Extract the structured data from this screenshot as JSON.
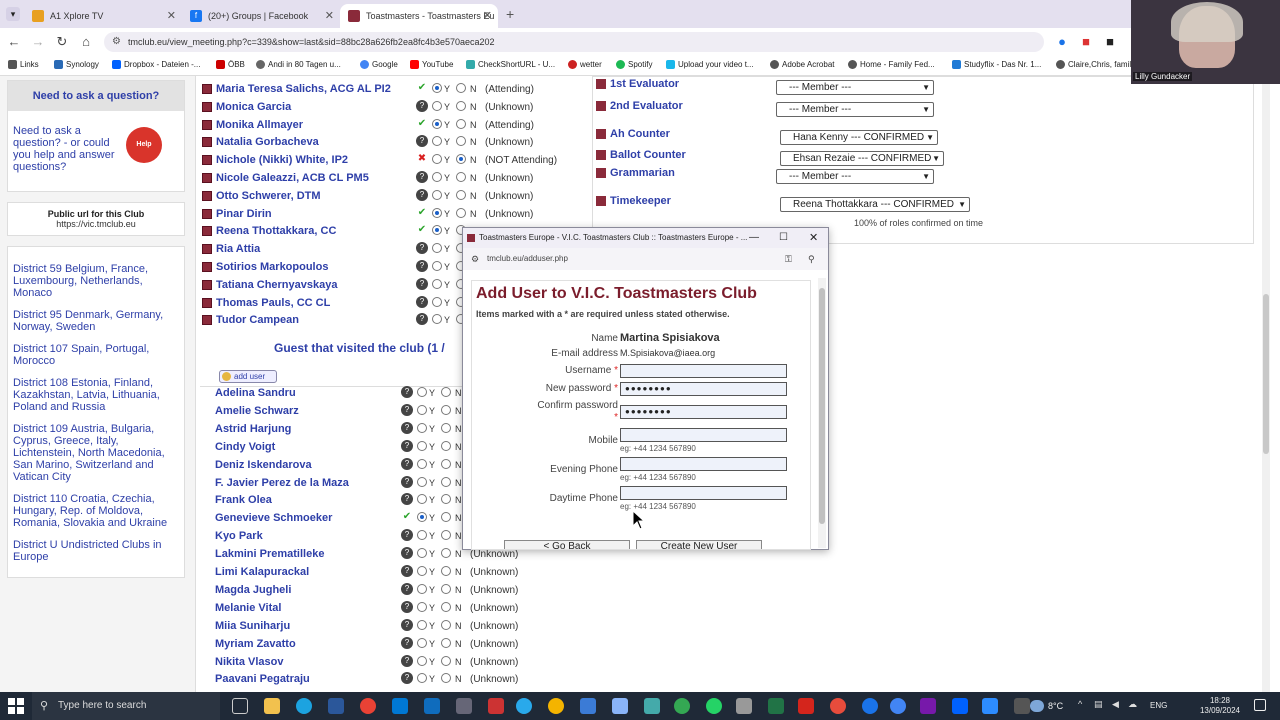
{
  "tabs": [
    {
      "label": "A1 Xplore TV",
      "color": "#e8a020"
    },
    {
      "label": "(20+) Groups | Facebook",
      "color": "#1877f2"
    },
    {
      "label": "Toastmasters - Toastmasters Eu",
      "color": "#8a2a3a"
    }
  ],
  "address": "tmclub.eu/view_meeting.php?c=339&show=last&sid=88bc28a626fb2ea8fc4b3e570aeca202",
  "bookmarks": [
    "Links",
    "Synology",
    "Dropbox - Dateien -...",
    "ÖBB",
    "Andi in 80 Tagen u...",
    "Google",
    "YouTube",
    "CheckShortURL - U...",
    "wetter",
    "Spotify",
    "Upload your video t...",
    "Adobe Acrobat",
    "Home - Family Fed...",
    "Studyflix - Das Nr. 1...",
    "Claire,Chris, family"
  ],
  "sidebar": {
    "question_title": "Need to ask a question?",
    "question_text": "Need to ask a question? - or could you help and answer questions?",
    "help_badge": "Help",
    "public_url_title": "Public url for this Club",
    "public_url": "https://vic.tmclub.eu",
    "districts": [
      "District 59 Belgium, France, Luxembourg, Netherlands, Monaco",
      "District 95 Denmark, Germany, Norway, Sweden",
      "District 107 Spain, Portugal, Morocco",
      "District 108 Estonia, Finland, Kazakhstan, Latvia, Lithuania, Poland and Russia",
      "District 109 Austria, Bulgaria, Cyprus, Greece, Italy, Lichtenstein, North Macedonia, San Marino, Switzerland and Vatican City",
      "District 110 Croatia, Czechia, Hungary, Rep. of Moldova, Romania, Slovakia and Ukraine",
      "District U Undistricted Clubs in Europe"
    ]
  },
  "members": [
    {
      "name": "Maria Teresa Salichs, ACG AL PI2",
      "mark": "ok",
      "sel": "y",
      "status": "(Attending)"
    },
    {
      "name": "Monica Garcia",
      "mark": "q",
      "sel": "",
      "status": "(Unknown)"
    },
    {
      "name": "Monika Allmayer",
      "mark": "ok",
      "sel": "y",
      "status": "(Attending)"
    },
    {
      "name": "Natalia Gorbacheva",
      "mark": "q",
      "sel": "",
      "status": "(Unknown)"
    },
    {
      "name": "Nichole (Nikki) White, IP2",
      "mark": "no",
      "sel": "n",
      "status": "(NOT Attending)"
    },
    {
      "name": "Nicole Galeazzi, ACB CL PM5",
      "mark": "q",
      "sel": "",
      "status": "(Unknown)"
    },
    {
      "name": "Otto Schwerer, DTM",
      "mark": "q",
      "sel": "",
      "status": "(Unknown)"
    },
    {
      "name": "Pinar Dirin",
      "mark": "ok",
      "sel": "y",
      "status": "(Unknown)"
    },
    {
      "name": "Reena Thottakkara, CC",
      "mark": "ok",
      "sel": "y",
      "status": ""
    },
    {
      "name": "Ria Attia",
      "mark": "q",
      "sel": "",
      "status": ""
    },
    {
      "name": "Sotirios Markopoulos",
      "mark": "q",
      "sel": "",
      "status": ""
    },
    {
      "name": "Tatiana Chernyavskaya",
      "mark": "q",
      "sel": "",
      "status": ""
    },
    {
      "name": "Thomas Pauls, CC CL",
      "mark": "q",
      "sel": "",
      "status": ""
    },
    {
      "name": "Tudor Campean",
      "mark": "q",
      "sel": "",
      "status": ""
    }
  ],
  "guest_heading": "Guest that visited the club (1 /",
  "add_user_label": "add user",
  "guests": [
    {
      "name": "Adelina Sandru",
      "mark": "q",
      "sel": "",
      "status": ""
    },
    {
      "name": "Amelie Schwarz",
      "mark": "q",
      "sel": "",
      "status": ""
    },
    {
      "name": "Astrid Harjung",
      "mark": "q",
      "sel": "",
      "status": ""
    },
    {
      "name": "Cindy Voigt",
      "mark": "q",
      "sel": "",
      "status": ""
    },
    {
      "name": "Deniz Iskendarova",
      "mark": "q",
      "sel": "",
      "status": ""
    },
    {
      "name": "F. Javier Perez de la Maza",
      "mark": "q",
      "sel": "",
      "status": ""
    },
    {
      "name": "Frank Olea",
      "mark": "q",
      "sel": "",
      "status": ""
    },
    {
      "name": "Genevieve Schmoeker",
      "mark": "ok",
      "sel": "y",
      "status": ""
    },
    {
      "name": "Kyo Park",
      "mark": "q",
      "sel": "",
      "status": ""
    },
    {
      "name": "Lakmini Prematilleke",
      "mark": "q",
      "sel": "",
      "status": "(Unknown)"
    },
    {
      "name": "Limi Kalapurackal",
      "mark": "q",
      "sel": "",
      "status": "(Unknown)"
    },
    {
      "name": "Magda Jugheli",
      "mark": "q",
      "sel": "",
      "status": "(Unknown)"
    },
    {
      "name": "Melanie Vital",
      "mark": "q",
      "sel": "",
      "status": "(Unknown)"
    },
    {
      "name": "Miia Suniharju",
      "mark": "q",
      "sel": "",
      "status": "(Unknown)"
    },
    {
      "name": "Myriam Zavatto",
      "mark": "q",
      "sel": "",
      "status": "(Unknown)"
    },
    {
      "name": "Nikita Vlasov",
      "mark": "q",
      "sel": "",
      "status": "(Unknown)"
    },
    {
      "name": "Paavani Pegatraju",
      "mark": "q",
      "sel": "",
      "status": "(Unknown)"
    }
  ],
  "yes_label": "Y",
  "no_label": "N",
  "roles": [
    {
      "label": "1st Evaluator",
      "value": "--- Member ---"
    },
    {
      "label": "2nd Evaluator",
      "value": "--- Member ---"
    },
    {
      "label": "Ah Counter",
      "value": "Hana Kenny --- CONFIRMED"
    },
    {
      "label": "Ballot Counter",
      "value": "Ehsan Rezaie --- CONFIRMED"
    },
    {
      "label": "Grammarian",
      "value": "--- Member ---"
    },
    {
      "label": "Timekeeper",
      "value": "Reena Thottakkara --- CONFIRMED"
    }
  ],
  "roles_confirmed": "100% of roles confirmed on time",
  "popup": {
    "title": "Toastmasters Europe - V.I.C. Toastmasters Club :: Toastmasters Europe - ...",
    "url": "tmclub.eu/adduser.php",
    "heading": "Add User to V.I.C. Toastmasters Club",
    "note": "Items marked with a * are required unless stated otherwise.",
    "name_label": "Name",
    "name_value": "Martina Spisiakova",
    "email_label": "E-mail address",
    "email_value": "M.Spisiakova@iaea.org",
    "username_label": "Username",
    "username_value": "",
    "password_label": "New password",
    "password_value": "●●●●●●●●",
    "confirm_label": "Confirm password",
    "confirm_value": "●●●●●●●●",
    "mobile_label": "Mobile",
    "evening_label": "Evening Phone",
    "daytime_label": "Daytime Phone",
    "phone_hint": "eg: +44 1234 567890",
    "back_button": "< Go Back",
    "create_button": "Create New User"
  },
  "webcam_name": "Lilly Gundacker",
  "taskbar": {
    "search_placeholder": "Type here to search",
    "weather": "8°C",
    "lang": "ENG",
    "time": "18:28",
    "date": "13/09/2024"
  }
}
